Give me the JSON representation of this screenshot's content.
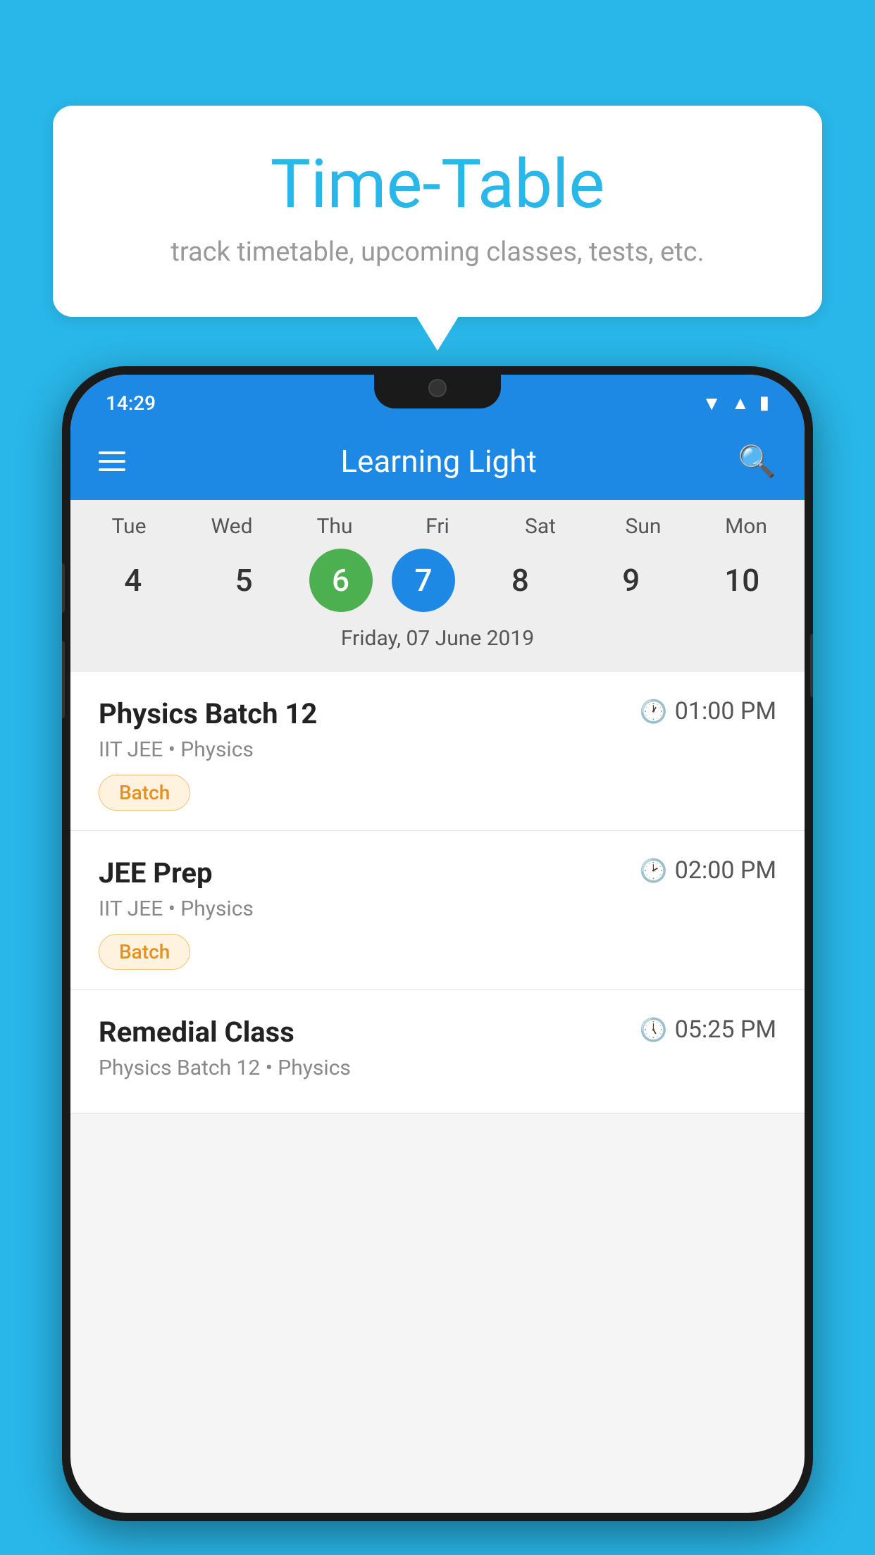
{
  "background_color": "#29B6E8",
  "bubble": {
    "title": "Time-Table",
    "subtitle": "track timetable, upcoming classes, tests, etc."
  },
  "phone": {
    "status_bar": {
      "time": "14:29"
    },
    "app_bar": {
      "title": "Learning Light"
    },
    "calendar": {
      "days": [
        {
          "name": "Tue",
          "num": "4",
          "state": "normal"
        },
        {
          "name": "Wed",
          "num": "5",
          "state": "normal"
        },
        {
          "name": "Thu",
          "num": "6",
          "state": "today"
        },
        {
          "name": "Fri",
          "num": "7",
          "state": "selected"
        },
        {
          "name": "Sat",
          "num": "8",
          "state": "normal"
        },
        {
          "name": "Sun",
          "num": "9",
          "state": "normal"
        },
        {
          "name": "Mon",
          "num": "10",
          "state": "normal"
        }
      ],
      "selected_date_label": "Friday, 07 June 2019"
    },
    "schedule_items": [
      {
        "title": "Physics Batch 12",
        "time": "01:00 PM",
        "subtitle": "IIT JEE • Physics",
        "tag": "Batch"
      },
      {
        "title": "JEE Prep",
        "time": "02:00 PM",
        "subtitle": "IIT JEE • Physics",
        "tag": "Batch"
      },
      {
        "title": "Remedial Class",
        "time": "05:25 PM",
        "subtitle": "Physics Batch 12 • Physics",
        "tag": ""
      }
    ]
  }
}
